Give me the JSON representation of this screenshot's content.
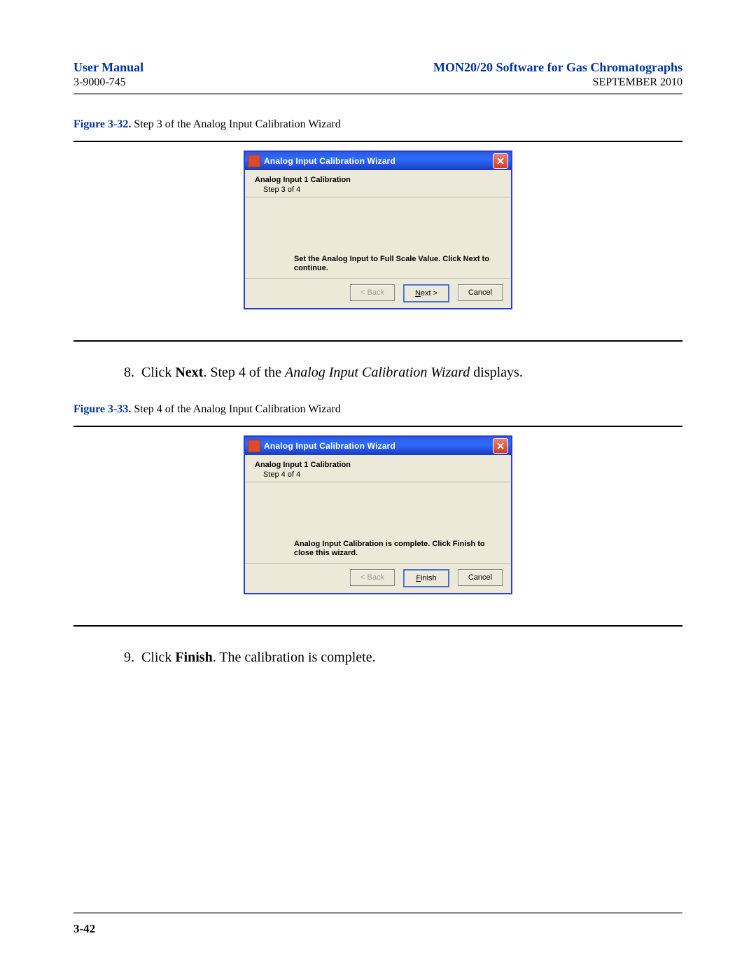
{
  "header": {
    "left_title": "User Manual",
    "right_title": "MON20/20 Software for Gas Chromatographs",
    "doc_number": "3-9000-745",
    "date": "SEPTEMBER 2010"
  },
  "figure_a": {
    "label": "Figure 3-32.",
    "caption": "Step 3 of the Analog Input Calibration Wizard",
    "dialog": {
      "title": "Analog Input Calibration Wizard",
      "heading": "Analog Input 1 Calibration",
      "step": "Step 3 of 4",
      "message": "Set the Analog Input to Full Scale Value. Click Next to continue.",
      "back_label": "< Back",
      "next_prefix": "N",
      "next_suffix": "ext >",
      "cancel_label": "Cancel"
    }
  },
  "step8": {
    "num": "8.",
    "p1": "Click ",
    "bold": "Next",
    "p2": ". Step 4 of the ",
    "italic": "Analog Input Calibration Wizard",
    "p3": " displays."
  },
  "figure_b": {
    "label": "Figure 3-33.",
    "caption": "Step 4 of the Analog Input Calibration Wizard",
    "dialog": {
      "title": "Analog Input Calibration Wizard",
      "heading": "Analog Input 1 Calibration",
      "step": "Step 4 of 4",
      "message": "Analog Input Calibration is complete. Click Finish to close this wizard.",
      "back_label": "< Back",
      "finish_prefix": "F",
      "finish_suffix": "inish",
      "cancel_label": "Cancel"
    }
  },
  "step9": {
    "num": "9.",
    "p1": "Click ",
    "bold": "Finish",
    "p2": ". The calibration is complete."
  },
  "footer": {
    "page": "3-42"
  }
}
